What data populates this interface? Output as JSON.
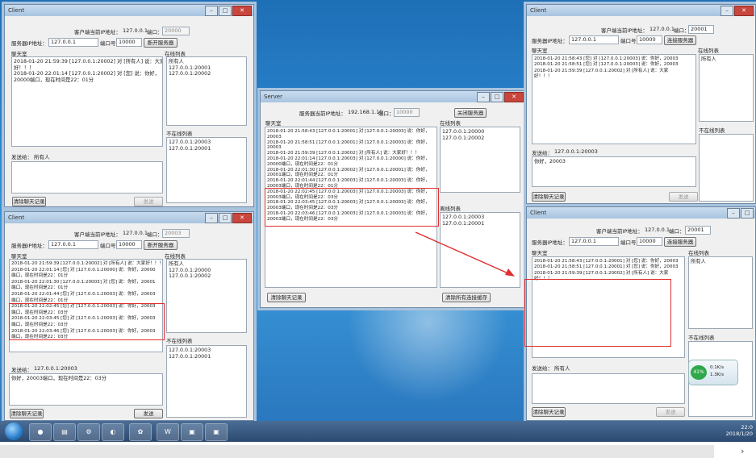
{
  "client_top_left": {
    "title": "Client",
    "client_addr_label": "客户端当前IP地址：",
    "client_addr_value": "127.0.0.1",
    "client_port_label": "端口：",
    "client_port_value": "20000",
    "server_addr_label": "服务器IP地址：",
    "server_addr_value": "127.0.0.1",
    "port_label": "端口号",
    "port_value": "10000",
    "connect_btn": "断开服务器",
    "chat_label": "聊天室",
    "online_label": "在线列表",
    "offline_label": "不在线列表",
    "chat_lines": [
      "2018-01-20 21:59:39 [127.0.0.1:20002] 对 [所有人] 说：大家",
      "好！！！",
      "2018-01-20 22:01:14 [127.0.0.1:20002] 对 [您] 说：你好，",
      "20000端口，现在时间是22：01分"
    ],
    "online_list": [
      "所有人",
      "127.0.0.1:20001",
      "127.0.0.1:20002"
    ],
    "offline_list": [
      "127.0.0.1:20003",
      "127.0.0.1:20001"
    ],
    "send_to_label": "发送给：",
    "send_to_value": "所有人",
    "clear_btn": "清除聊天记录",
    "send_btn": "发送"
  },
  "client_bottom_left": {
    "title": "Client",
    "client_addr_label": "客户端当前IP地址：",
    "client_addr_value": "127.0.0.1",
    "client_port_label": "端口：",
    "client_port_value": "20003",
    "server_addr_label": "服务器IP地址：",
    "server_addr_value": "127.0.0.1",
    "port_label": "端口号",
    "port_value": "10000",
    "connect_btn": "断开服务器",
    "chat_label": "聊天室",
    "online_label": "在线列表",
    "offline_label": "不在线列表",
    "chat_lines": [
      "2018-01-20 21:59:39 [127.0.0.1:20002] 对 [所有人] 说：大家好！！！",
      "2018-01-20 22:01:14 [您] 对 [127.0.0.1:20000] 说：你好，20000",
      "端口，现在时间是22：01分",
      "2018-01-20 22:01:30 [127.0.0.1:20003] 对 [您] 说：你好，20001",
      "端口，现在时间是22：01分",
      "2018-01-20 22:01:44 [您] 对 [127.0.0.1:20003] 说：你好，20003",
      "端口，现在时间是22：01分",
      "2018-01-20 22:02:45 [您] 对 [127.0.0.1:20003] 说：你好，20003",
      "端口，现在时间是22：03分",
      "2018-01-20 22:03:45 [您] 对 [127.0.0.1:20003] 说：你好，20003",
      "端口，现在时间是22：03分",
      "2018-01-20 22:03:46 [您] 对 [127.0.0.1:20003] 说：你好，20003",
      "端口，现在时间是22：03分"
    ],
    "online_list": [
      "所有人",
      "127.0.0.1:20000",
      "127.0.0.1:20002"
    ],
    "offline_list": [
      "127.0.0.1:20003",
      "127.0.0.1:20001"
    ],
    "send_to_label": "发送给：",
    "send_to_value": "127.0.0.1:20003",
    "message_value": "你好，20003端口，现在时间是22：03分",
    "clear_btn": "清除聊天记录",
    "send_btn": "发送"
  },
  "server": {
    "title": "Server",
    "server_addr_label": "服务器当前IP地址：",
    "server_addr_value": "192.168.1.10",
    "port_label": "端口：",
    "port_value": "10000",
    "close_btn": "关闭服务器",
    "chat_label": "聊天室",
    "online_label": "在线列表",
    "offline_label": "离线列表",
    "chat_lines": [
      "2018-01-20 21:58:43 [127.0.0.1:20001] 对 [127.0.0.1:20003] 说：你好，",
      "20003",
      "2018-01-20 21:58:51 [127.0.0.1:20001] 对 [127.0.0.1:20003] 说：你好，",
      "20003",
      "2018-01-20 21:59:39 [127.0.0.1:20002] 对 [所有人] 说：大家好！！！",
      "2018-01-20 22:01:14 [127.0.0.1:20003] 对 [127.0.0.1:20000] 说：你好，",
      "20000端口，现在时间是22：01分",
      "2018-01-20 22:01:30 [127.0.0.1:20002] 对 [127.0.0.1:20001] 说：你好，",
      "20001端口，现在时间是22：01分",
      "2018-01-20 22:01:44 [127.0.0.1:20003] 对 [127.0.0.1:20003] 说：你好，",
      "20003端口，现在时间是22：01分",
      "2018-01-20 22:02:45 [127.0.0.1:20003] 对 [127.0.0.1:20003] 说：你好，",
      "20003端口，现在时间是22：03分",
      "2018-01-20 22:03:45 [127.0.0.1:20003] 对 [127.0.0.1:20003] 说：你好，",
      "20003端口，现在时间是22：03分",
      "2018-01-20 22:03:46 [127.0.0.1:20003] 对 [127.0.0.1:20003] 说：你好，",
      "20003端口，现在时间是22：03分"
    ],
    "online_list": [
      "127.0.0.1:20000",
      "127.0.0.1:20002"
    ],
    "offline_list": [
      "127.0.0.1:20003",
      "127.0.0.1:20001"
    ],
    "clear_btn": "清除聊天记录",
    "clear_offline_btn": "清除所有连接缓存"
  },
  "client_top_right": {
    "title": "Client",
    "client_addr_label": "客户端当前IP地址：",
    "client_addr_value": "127.0.0.1",
    "client_port_label": "端口：",
    "client_port_value": "20001",
    "server_addr_label": "服务器IP地址：",
    "server_addr_value": "127.0.0.1",
    "port_label": "端口号",
    "port_value": "10000",
    "connect_btn": "连接服务器",
    "chat_label": "聊天室",
    "online_label": "在线列表",
    "offline_label": "不在线列表",
    "chat_lines": [
      "2018-01-20 21:58:43 [您] 对 [127.0.0.1:20003] 说：你好，20003",
      "2018-01-20 21:58:51 [您] 对 [127.0.0.1:20003] 说：你好，20003",
      "2018-01-20 21:59:39 [127.0.0.1:20002] 对 [所有人] 说：大家",
      "好！！！"
    ],
    "online_list": [
      "所有人"
    ],
    "send_to_label": "发送给：",
    "send_to_value": "127.0.0.1:20003",
    "message_value": "你好，20003",
    "clear_btn": "清除聊天记录",
    "send_btn": "发送"
  },
  "client_bottom_right": {
    "title": "Client",
    "client_addr_label": "客户端当前IP地址：",
    "client_addr_value": "127.0.0.1",
    "client_port_label": "端口：",
    "client_port_value": "20001",
    "server_addr_label": "服务器IP地址：",
    "server_addr_value": "127.0.0.1",
    "port_label": "端口号",
    "port_value": "10000",
    "connect_btn": "连接服务器",
    "chat_label": "聊天室",
    "online_label": "在线列表",
    "offline_label": "不在线列表",
    "chat_lines": [
      "2018-01-20 21:58:43 [127.0.0.1:20001] 对 [您] 说：你好，20003",
      "2018-01-20 21:58:51 [127.0.0.1:20001] 对 [您] 说：你好，20003",
      "2018-01-20 21:59:39 [127.0.0.1:20002] 对 [所有人] 说：大家",
      "好！！！"
    ],
    "online_list": [
      "所有人"
    ],
    "send_to_label": "发送给：",
    "send_to_value": "所有人",
    "clear_btn": "清除聊天记录",
    "send_btn": "发送"
  },
  "gadget": {
    "percent": "41%",
    "up": "0.1K/s",
    "down": "1.3K/s"
  },
  "tray": {
    "time": "22:0",
    "date": "2018/1/20"
  },
  "colors": {
    "highlight_red": "#e03030",
    "titlebar": "#b6cde5",
    "desktop": "#2b86cf"
  }
}
